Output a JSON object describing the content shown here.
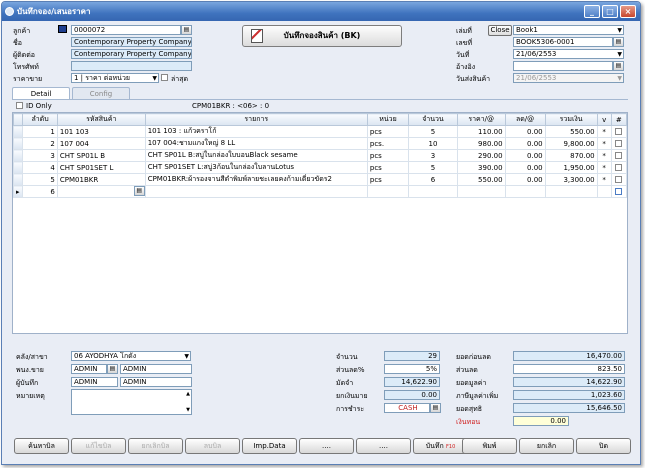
{
  "window": {
    "title": "บันทึกจอง/เสนอราคา",
    "min": "_",
    "max": "□",
    "close": "×"
  },
  "header": {
    "customer_label": "ลูกค้า",
    "customer_code": "0000072",
    "name_label": "ชื่อ",
    "name_value": "Contemporary Property Company Limite",
    "contact_label": "ผู้ติดต่อ",
    "contact_value": "Contemporary Property Company Limite",
    "phone_label": "โทรศัพท์",
    "phone_value": "",
    "price_label": "ราคาขาย",
    "price_value": "1 | ราคา ต่อหน่วย",
    "latest_label": "ล่าสุด",
    "save_booking_label": "บันทึกจองสินค้า (BK)",
    "book_label": "เล่มที่",
    "close_label": "Close",
    "book_value": "Book1",
    "doc_label": "เลขที่",
    "doc_value": "BOOK5306-0001",
    "date_label": "วันที่",
    "date_value": "21/06/2553",
    "ref_label": "อ้างอิง",
    "ref_value": "",
    "delivery_label": "วันส่งสินค้า",
    "delivery_value": "21/06/2553"
  },
  "tabs": [
    {
      "label": "Detail"
    },
    {
      "label": "Config"
    }
  ],
  "id_only_label": "ID Only",
  "info_text": "CPM01BKR : <06> : 0",
  "table": {
    "columns": [
      "ลำดับ",
      "รหัสสินค้า",
      "รายการ",
      "หน่วย",
      "จำนวน",
      "ราคา/@",
      "ลด/@",
      "รวมเงิน",
      "v",
      "#"
    ],
    "rows": [
      {
        "no": "1",
        "code": "101 103",
        "desc": "101 103 : แก้วคราโก้",
        "unit": "pcs",
        "qty": "5",
        "price": "110.00",
        "disc": "0.00",
        "total": "550.00",
        "v": "*"
      },
      {
        "no": "2",
        "code": "107 004",
        "desc": "107 004:ชามแกงใหญ่  8   LL",
        "unit": "pcs.",
        "qty": "10",
        "price": "980.00",
        "disc": "0.00",
        "total": "9,800.00",
        "v": "*"
      },
      {
        "no": "3",
        "code": "CHT SP01L B",
        "desc": "CHT SP01L B:สบู่ในกล่องใบบอนBlack sesame",
        "unit": "pcs",
        "qty": "3",
        "price": "290.00",
        "disc": "0.00",
        "total": "870.00",
        "v": "*"
      },
      {
        "no": "4",
        "code": "CHT SP01SET L",
        "desc": "CHT SP01SET L:สบู่3ก้อนในกล่องใบลานLotus",
        "unit": "pcs",
        "qty": "5",
        "price": "390.00",
        "disc": "0.00",
        "total": "1,950.00",
        "v": "*"
      },
      {
        "no": "5",
        "code": "CPM01BKR",
        "desc": "CPM01BKR:ผ้ารองจานสีดำพิมพ์ลายชะเลยคงก้ามเดี่ยวขัดร2",
        "unit": "pcs",
        "qty": "6",
        "price": "550.00",
        "disc": "0.00",
        "total": "3,300.00",
        "v": "*"
      },
      {
        "no": "6",
        "code": "",
        "desc": "",
        "unit": "",
        "qty": "",
        "price": "",
        "disc": "",
        "total": "",
        "v": ""
      }
    ]
  },
  "footer": {
    "warehouse_label": "คลัง/สาขา",
    "warehouse_value": "06  AYODHYA โกดัง",
    "sales_label": "พนง.ขาย",
    "sales_code": "ADMIN",
    "sales_name": "ADMIN",
    "recorder_label": "ผู้บันทึก",
    "recorder_code": "ADMIN",
    "recorder_name": "ADMIN",
    "note_label": "หมายเหตุ",
    "qty_label": "จำนวน",
    "qty_value": "29",
    "discpct_label": "ส่วนลด%",
    "discpct_value": "5%",
    "deposit_label": "มัดจำ",
    "deposit_value": "14,622.90",
    "advance_label": "ยกเงินมาย",
    "advance_value": "0.00",
    "pay_label": "การชำระ",
    "pay_value": "CASH",
    "subtotal_label": "ยอดก่อนลด",
    "subtotal_value": "16,470.00",
    "discount_label": "ส่วนลด",
    "discount_value": "823.50",
    "value_label": "ยอดมูลค่า",
    "value_value": "14,622.90",
    "vat_label": "ภาษีมูลค่าเพิ่ม",
    "vat_value": "1,023.60",
    "net_label": "ยอดสุทธิ",
    "net_value": "15,646.50",
    "change_label": "เงินทอน",
    "change_value": "0.00"
  },
  "buttons": {
    "search": "ค้นหาบิล",
    "edit": "แก้ไขบิล",
    "cancel_bill": "ยกเลิกบิล",
    "delete": "ลบบิล",
    "imp": "Imp.Data",
    "dots1": "....",
    "dots2": "....",
    "save": "บันทึก",
    "save_key": "F10",
    "print": "พิมพ์",
    "cancel": "ยกเลิก",
    "close": "ปิด"
  }
}
